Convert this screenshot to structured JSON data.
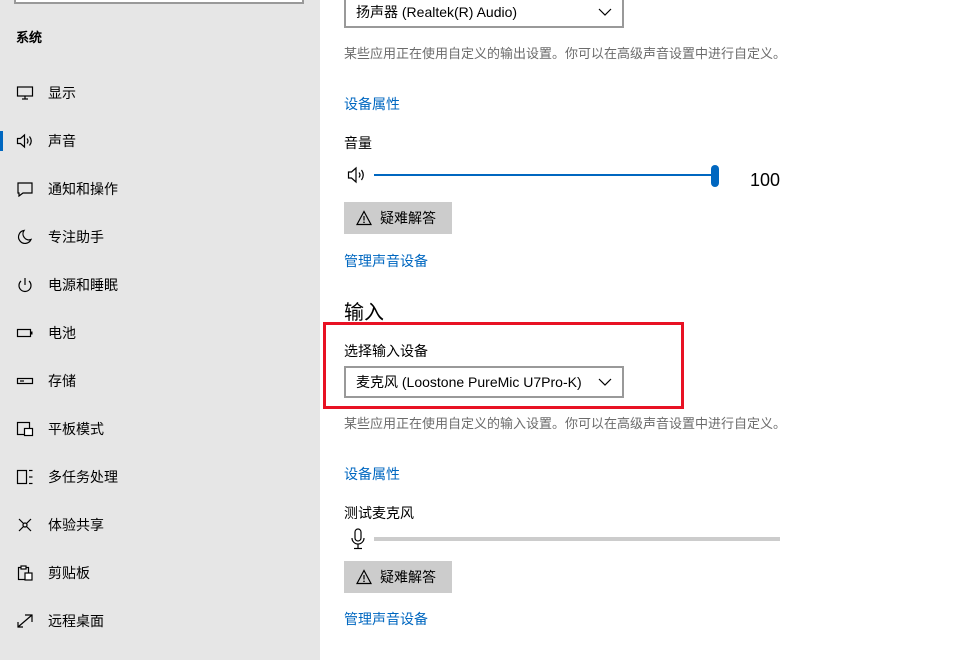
{
  "sidebar": {
    "section_title": "系统",
    "items": [
      {
        "label": "显示",
        "icon": "monitor-icon"
      },
      {
        "label": "声音",
        "icon": "speaker-icon",
        "active": true
      },
      {
        "label": "通知和操作",
        "icon": "notification-icon"
      },
      {
        "label": "专注助手",
        "icon": "moon-icon"
      },
      {
        "label": "电源和睡眠",
        "icon": "power-icon"
      },
      {
        "label": "电池",
        "icon": "battery-icon"
      },
      {
        "label": "存储",
        "icon": "storage-icon"
      },
      {
        "label": "平板模式",
        "icon": "tablet-icon"
      },
      {
        "label": "多任务处理",
        "icon": "multitask-icon"
      },
      {
        "label": "体验共享",
        "icon": "share-icon"
      },
      {
        "label": "剪贴板",
        "icon": "clipboard-icon"
      },
      {
        "label": "远程桌面",
        "icon": "remote-desktop-icon"
      }
    ]
  },
  "output": {
    "device_value": "扬声器 (Realtek(R) Audio)",
    "desc": "某些应用正在使用自定义的输出设置。你可以在高级声音设置中进行自定义。",
    "device_properties": "设备属性",
    "volume_label": "音量",
    "volume_value": "100",
    "volume_level": 1.0,
    "troubleshoot": "疑难解答",
    "manage_devices": "管理声音设备"
  },
  "input": {
    "heading": "输入",
    "select_label": "选择输入设备",
    "device_value": "麦克风 (Loostone PureMic U7Pro-K)",
    "desc": "某些应用正在使用自定义的输入设置。你可以在高级声音设置中进行自定义。",
    "device_properties": "设备属性",
    "test_label": "测试麦克风",
    "mic_level": 0.0,
    "troubleshoot": "疑难解答",
    "manage_devices": "管理声音设备"
  },
  "colors": {
    "accent": "#0067c0",
    "highlight": "#e81123",
    "sidebar_bg": "#e6e6e6"
  }
}
